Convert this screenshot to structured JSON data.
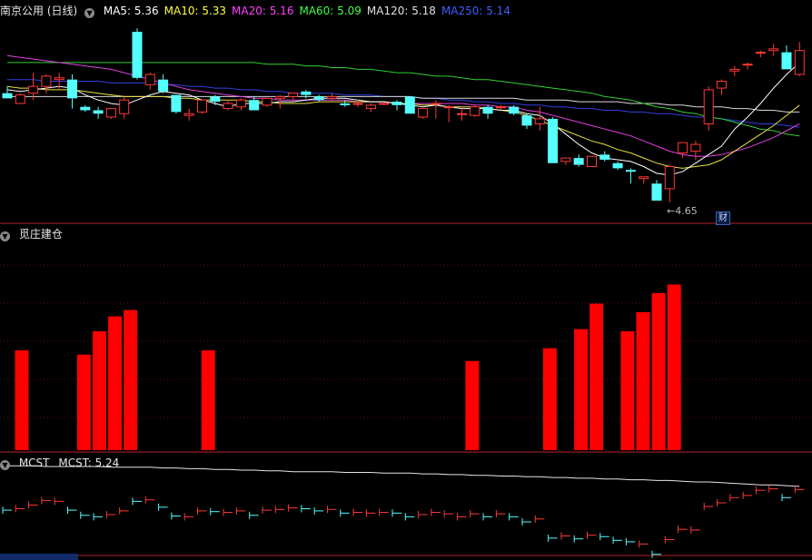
{
  "panel1": {
    "title": "南京公用 (日线)",
    "ma": [
      {
        "label": "MA5: 5.36",
        "color": "#ffffff"
      },
      {
        "label": "MA10: 5.33",
        "color": "#ffff40"
      },
      {
        "label": "MA20: 5.16",
        "color": "#ff40ff"
      },
      {
        "label": "MA60: 5.09",
        "color": "#40ff40"
      },
      {
        "label": "MA120: 5.18",
        "color": "#e0e0e0"
      },
      {
        "label": "MA250: 5.14",
        "color": "#4060ff"
      }
    ],
    "low_label": "4.65",
    "cai_badge": "财"
  },
  "panel2": {
    "title": "觅庄建仓"
  },
  "panel3": {
    "title": "MCST",
    "value_label": "MCST: 5.24"
  },
  "colors": {
    "up": "#ff3838",
    "down": "#54ffff",
    "bar": "#ff0000",
    "separator": "#b0232a",
    "grid": "#5a1212"
  },
  "chart_data": {
    "type": "candlestick",
    "candles": [
      [
        5.34,
        5.38,
        5.31,
        5.31
      ],
      [
        5.28,
        5.34,
        5.28,
        5.33
      ],
      [
        5.34,
        5.46,
        5.3,
        5.38
      ],
      [
        5.38,
        5.45,
        5.34,
        5.44
      ],
      [
        5.42,
        5.46,
        5.36,
        5.43
      ],
      [
        5.42,
        5.45,
        5.25,
        5.31
      ],
      [
        5.26,
        5.27,
        5.23,
        5.24
      ],
      [
        5.24,
        5.26,
        5.19,
        5.22
      ],
      [
        5.2,
        5.25,
        5.19,
        5.25
      ],
      [
        5.22,
        5.32,
        5.19,
        5.3
      ],
      [
        5.7,
        5.72,
        5.42,
        5.43
      ],
      [
        5.39,
        5.46,
        5.36,
        5.45
      ],
      [
        5.42,
        5.45,
        5.34,
        5.35
      ],
      [
        5.33,
        5.33,
        5.22,
        5.23
      ],
      [
        5.21,
        5.25,
        5.18,
        5.22
      ],
      [
        5.23,
        5.3,
        5.22,
        5.3
      ],
      [
        5.32,
        5.33,
        5.27,
        5.29
      ],
      [
        5.25,
        5.3,
        5.24,
        5.28
      ],
      [
        5.26,
        5.31,
        5.24,
        5.3
      ],
      [
        5.3,
        5.32,
        5.24,
        5.24
      ],
      [
        5.27,
        5.31,
        5.26,
        5.31
      ],
      [
        5.31,
        5.33,
        5.25,
        5.32
      ],
      [
        5.32,
        5.34,
        5.3,
        5.34
      ],
      [
        5.35,
        5.36,
        5.31,
        5.33
      ],
      [
        5.32,
        5.33,
        5.29,
        5.3
      ],
      [
        5.31,
        5.34,
        5.3,
        5.32
      ],
      [
        5.28,
        5.3,
        5.26,
        5.27
      ],
      [
        5.28,
        5.3,
        5.26,
        5.28
      ],
      [
        5.25,
        5.28,
        5.23,
        5.27
      ],
      [
        5.28,
        5.28,
        5.27,
        5.28
      ],
      [
        5.29,
        5.3,
        5.24,
        5.27
      ],
      [
        5.32,
        5.32,
        5.22,
        5.22
      ],
      [
        5.2,
        5.25,
        5.19,
        5.25
      ],
      [
        5.28,
        5.3,
        5.19,
        5.28
      ],
      [
        5.26,
        5.27,
        5.17,
        5.26
      ],
      [
        5.22,
        5.26,
        5.18,
        5.22
      ],
      [
        5.21,
        5.27,
        5.2,
        5.26
      ],
      [
        5.26,
        5.27,
        5.19,
        5.22
      ],
      [
        5.26,
        5.27,
        5.24,
        5.26
      ],
      [
        5.26,
        5.27,
        5.21,
        5.22
      ],
      [
        5.21,
        5.22,
        5.13,
        5.15
      ],
      [
        5.16,
        5.26,
        5.12,
        5.19
      ],
      [
        5.19,
        5.2,
        4.93,
        4.93
      ],
      [
        4.94,
        4.96,
        4.92,
        4.96
      ],
      [
        4.96,
        4.98,
        4.91,
        4.92
      ],
      [
        4.91,
        4.97,
        4.91,
        4.97
      ],
      [
        4.98,
        5.0,
        4.94,
        4.95
      ],
      [
        4.93,
        4.94,
        4.89,
        4.9
      ],
      [
        4.89,
        4.9,
        4.81,
        4.88
      ],
      [
        4.84,
        4.85,
        4.81,
        4.85
      ],
      [
        4.81,
        4.83,
        4.71,
        4.71
      ],
      [
        4.78,
        4.92,
        4.7,
        4.91
      ],
      [
        4.99,
        5.05,
        4.96,
        5.05
      ],
      [
        5.0,
        5.06,
        4.95,
        5.04
      ],
      [
        5.16,
        5.38,
        5.12,
        5.36
      ],
      [
        5.37,
        5.42,
        5.33,
        5.41
      ],
      [
        5.47,
        5.5,
        5.44,
        5.48
      ],
      [
        5.51,
        5.52,
        5.48,
        5.51
      ],
      [
        5.58,
        5.59,
        5.55,
        5.58
      ],
      [
        5.59,
        5.63,
        5.56,
        5.6
      ],
      [
        5.58,
        5.62,
        5.48,
        5.48
      ],
      [
        5.45,
        5.64,
        5.44,
        5.59
      ]
    ],
    "ma5": [
      5.36,
      5.35,
      5.36,
      5.37,
      5.38,
      5.37,
      5.33,
      5.3,
      5.28,
      5.27,
      5.3,
      5.33,
      5.35,
      5.34,
      5.33,
      5.3,
      5.28,
      5.26,
      5.28,
      5.28,
      5.28,
      5.29,
      5.29,
      5.3,
      5.31,
      5.31,
      5.31,
      5.3,
      5.29,
      5.29,
      5.28,
      5.27,
      5.26,
      5.27,
      5.26,
      5.25,
      5.25,
      5.25,
      5.24,
      5.24,
      5.22,
      5.21,
      5.16,
      5.1,
      5.04,
      4.99,
      4.96,
      4.95,
      4.94,
      4.91,
      4.87,
      4.86,
      4.88,
      4.93,
      4.98,
      5.03,
      5.13,
      5.2,
      5.28,
      5.37,
      5.45,
      5.52
    ],
    "ma10": [
      5.38,
      5.37,
      5.37,
      5.36,
      5.36,
      5.36,
      5.35,
      5.34,
      5.33,
      5.32,
      5.32,
      5.32,
      5.32,
      5.31,
      5.31,
      5.3,
      5.3,
      5.3,
      5.3,
      5.29,
      5.29,
      5.28,
      5.28,
      5.28,
      5.29,
      5.29,
      5.29,
      5.29,
      5.29,
      5.29,
      5.28,
      5.28,
      5.27,
      5.27,
      5.26,
      5.26,
      5.26,
      5.25,
      5.24,
      5.23,
      5.21,
      5.18,
      5.15,
      5.12,
      5.09,
      5.06,
      5.04,
      5.01,
      4.99,
      4.96,
      4.93,
      4.91,
      4.9,
      4.91,
      4.92,
      4.95,
      5.0,
      5.05,
      5.1,
      5.15,
      5.21,
      5.27
    ],
    "ma20": [
      5.56,
      5.55,
      5.54,
      5.53,
      5.52,
      5.51,
      5.5,
      5.49,
      5.48,
      5.46,
      5.44,
      5.42,
      5.4,
      5.38,
      5.36,
      5.35,
      5.34,
      5.33,
      5.32,
      5.31,
      5.31,
      5.3,
      5.3,
      5.3,
      5.3,
      5.3,
      5.3,
      5.29,
      5.29,
      5.29,
      5.28,
      5.28,
      5.28,
      5.28,
      5.28,
      5.28,
      5.27,
      5.27,
      5.26,
      5.26,
      5.24,
      5.23,
      5.21,
      5.19,
      5.17,
      5.15,
      5.13,
      5.11,
      5.09,
      5.06,
      5.03,
      5.0,
      4.98,
      4.97,
      4.97,
      4.98,
      5.0,
      5.02,
      5.05,
      5.08,
      5.12,
      5.16
    ],
    "ma60": [
      5.52,
      5.52,
      5.52,
      5.52,
      5.52,
      5.52,
      5.52,
      5.52,
      5.52,
      5.52,
      5.52,
      5.52,
      5.52,
      5.52,
      5.52,
      5.52,
      5.52,
      5.52,
      5.52,
      5.52,
      5.51,
      5.51,
      5.51,
      5.5,
      5.5,
      5.49,
      5.49,
      5.48,
      5.48,
      5.47,
      5.46,
      5.46,
      5.45,
      5.44,
      5.44,
      5.43,
      5.42,
      5.42,
      5.41,
      5.4,
      5.39,
      5.38,
      5.37,
      5.36,
      5.35,
      5.34,
      5.32,
      5.31,
      5.3,
      5.28,
      5.26,
      5.25,
      5.23,
      5.22,
      5.2,
      5.19,
      5.17,
      5.15,
      5.13,
      5.12,
      5.1,
      5.09
    ],
    "ma120": [
      5.32,
      5.32,
      5.32,
      5.32,
      5.32,
      5.32,
      5.32,
      5.32,
      5.32,
      5.32,
      5.32,
      5.32,
      5.32,
      5.32,
      5.32,
      5.32,
      5.32,
      5.32,
      5.32,
      5.32,
      5.32,
      5.32,
      5.32,
      5.32,
      5.32,
      5.32,
      5.32,
      5.32,
      5.32,
      5.32,
      5.32,
      5.32,
      5.31,
      5.31,
      5.31,
      5.31,
      5.31,
      5.31,
      5.31,
      5.31,
      5.3,
      5.3,
      5.3,
      5.3,
      5.29,
      5.29,
      5.29,
      5.29,
      5.28,
      5.28,
      5.28,
      5.27,
      5.27,
      5.26,
      5.26,
      5.26,
      5.25,
      5.25,
      5.24,
      5.24,
      5.23,
      5.23
    ],
    "ma250": [
      5.42,
      5.42,
      5.42,
      5.41,
      5.41,
      5.41,
      5.41,
      5.41,
      5.4,
      5.4,
      5.4,
      5.4,
      5.39,
      5.39,
      5.38,
      5.38,
      5.37,
      5.37,
      5.36,
      5.36,
      5.35,
      5.35,
      5.34,
      5.34,
      5.34,
      5.34,
      5.33,
      5.33,
      5.33,
      5.32,
      5.32,
      5.32,
      5.31,
      5.31,
      5.3,
      5.3,
      5.29,
      5.29,
      5.28,
      5.28,
      5.27,
      5.27,
      5.26,
      5.26,
      5.25,
      5.25,
      5.24,
      5.24,
      5.23,
      5.23,
      5.22,
      5.22,
      5.21,
      5.2,
      5.2,
      5.19,
      5.18,
      5.17,
      5.16,
      5.16,
      5.15,
      5.14
    ],
    "ylim": [
      4.62,
      5.78
    ],
    "jianzhang_bars": [
      0.47,
      0,
      0,
      0,
      0.45,
      0.56,
      0.63,
      0.66,
      0,
      0,
      0,
      0,
      0.47,
      0,
      0,
      0,
      0,
      0,
      0,
      0,
      0,
      0,
      0,
      0,
      0,
      0,
      0,
      0,
      0,
      0.42,
      0,
      0,
      0,
      0,
      0.48,
      0,
      0.57,
      0.69,
      0,
      0.56,
      0.65,
      0.74,
      0.78,
      0
    ],
    "jianzhang_ylim": [
      0,
      1
    ],
    "mcst_ylim": [
      4.62,
      5.78
    ]
  }
}
